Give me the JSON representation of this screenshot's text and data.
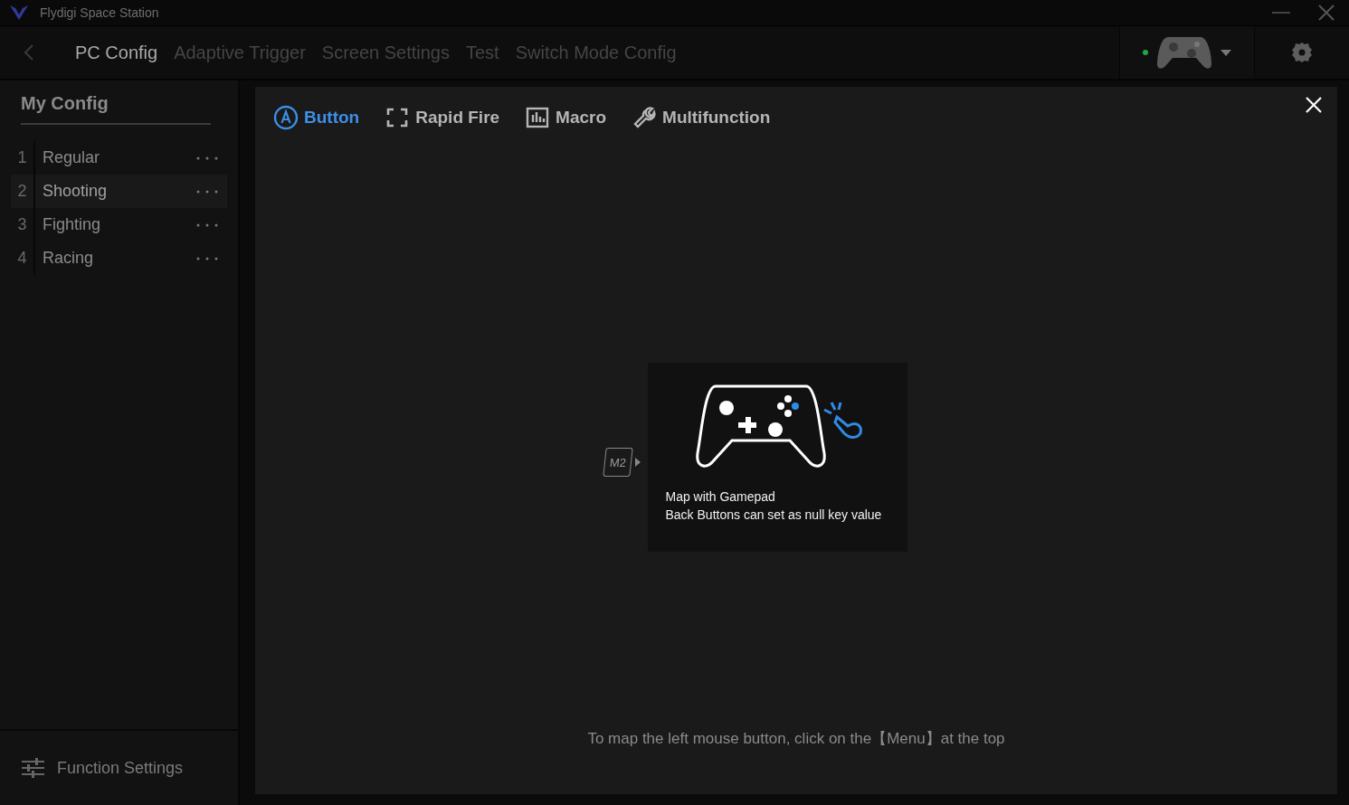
{
  "window": {
    "title": "Flydigi Space Station"
  },
  "nav": {
    "tabs": [
      {
        "label": "PC Config",
        "selected": true
      },
      {
        "label": "Adaptive Trigger",
        "selected": false
      },
      {
        "label": "Screen Settings",
        "selected": false
      },
      {
        "label": "Test",
        "selected": false
      },
      {
        "label": "Switch Mode Config",
        "selected": false
      }
    ],
    "device_connected": true
  },
  "sidebar": {
    "title": "My Config",
    "items": [
      {
        "number": "1",
        "name": "Regular",
        "selected": false
      },
      {
        "number": "2",
        "name": "Shooting",
        "selected": true
      },
      {
        "number": "3",
        "name": "Fighting",
        "selected": false
      },
      {
        "number": "4",
        "name": "Racing",
        "selected": false
      }
    ],
    "footer": "Function Settings"
  },
  "panel": {
    "tabs": [
      {
        "label": "Button",
        "selected": true
      },
      {
        "label": "Rapid Fire",
        "selected": false
      },
      {
        "label": "Macro",
        "selected": false
      },
      {
        "label": "Multifunction",
        "selected": false
      }
    ],
    "key_label": "M2",
    "card": {
      "title": "Map with Gamepad",
      "subtitle": "Back Buttons can set as null key value"
    },
    "hint": "To map the left mouse button, click on the【Menu】at the top"
  }
}
